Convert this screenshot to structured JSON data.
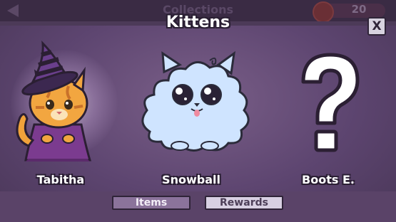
{
  "header": {
    "dimmed_title": "Collections",
    "coin_count": "20",
    "title": "Kittens",
    "close_label": "X"
  },
  "collection": {
    "items": [
      {
        "name": "Tabitha",
        "state": "unlocked",
        "art": "witch-cat"
      },
      {
        "name": "Snowball",
        "state": "unlocked",
        "art": "fluffy-white-cat"
      },
      {
        "name": "Boots E.",
        "state": "locked",
        "art": "question-mark"
      }
    ]
  },
  "tabs": {
    "items_label": "Items",
    "rewards_label": "Rewards",
    "active": "Rewards"
  },
  "colors": {
    "background": "#5d4570",
    "tab_active": "#d8d0e2",
    "tab_inactive": "#8b739b"
  }
}
